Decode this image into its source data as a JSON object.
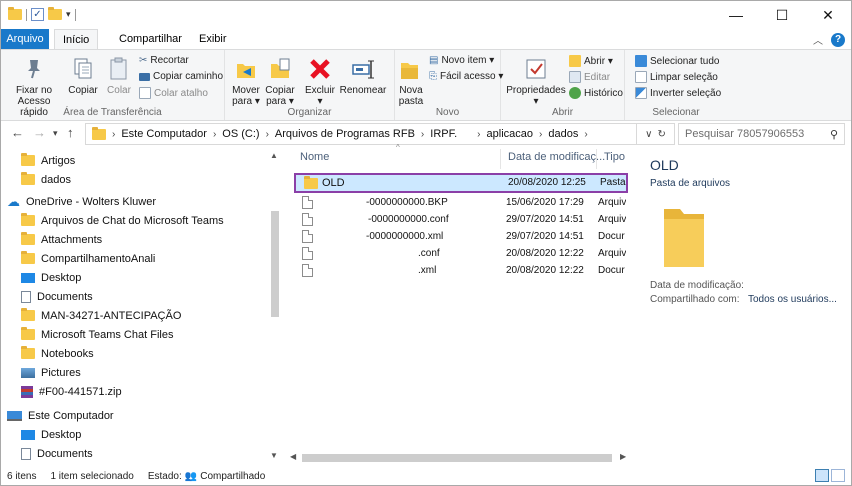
{
  "ribbon_tabs": {
    "file": "Arquivo",
    "home": "Início",
    "share": "Compartilhar",
    "view": "Exibir"
  },
  "window_controls": {
    "minimize": "—",
    "maximize": "☐",
    "close": "✕"
  },
  "clipboard": {
    "pin": "Fixar no\nAcesso rápido",
    "pin_l1": "Fixar no",
    "pin_l2": "Acesso rápido",
    "copy": "Copiar",
    "paste": "Colar",
    "cut": "Recortar",
    "copy_path": "Copiar caminho",
    "paste_shortcut": "Colar atalho",
    "group_label": "Área de Transferência"
  },
  "organize": {
    "move_l1": "Mover",
    "move_l2": "para ▾",
    "copy_l1": "Copiar",
    "copy_l2": "para ▾",
    "delete": "Excluir",
    "delete_arrow": "▾",
    "rename": "Renomear",
    "group_label": "Organizar"
  },
  "new": {
    "new_folder_l1": "Nova",
    "new_folder_l2": "pasta",
    "new_item": "Novo item ▾",
    "easy_access": "Fácil acesso ▾",
    "group_label": "Novo"
  },
  "open": {
    "properties": "Propriedades",
    "properties_arrow": "▾",
    "open": "Abrir ▾",
    "edit": "Editar",
    "history": "Histórico",
    "group_label": "Abrir"
  },
  "select": {
    "select_all": "Selecionar tudo",
    "clear": "Limpar seleção",
    "invert": "Inverter seleção",
    "group_label": "Selecionar"
  },
  "breadcrumb": [
    "Este Computador",
    "OS (C:)",
    "Arquivos de Programas RFB",
    "IRPF.",
    "aplicacao",
    "dados"
  ],
  "search": {
    "placeholder": "Pesquisar 78057906553"
  },
  "nav_items": [
    "Artigos",
    "dados",
    "OneDrive - Wolters Kluwer",
    "Arquivos de Chat do Microsoft Teams",
    "Attachments",
    "CompartilhamentoAnali",
    "Desktop",
    "Documents",
    "MAN-34271-ANTECIPAÇÃO",
    "Microsoft Teams Chat Files",
    "Notebooks",
    "Pictures",
    "#F00-441571.zip",
    "Este Computador",
    "Desktop",
    "Documents"
  ],
  "columns": {
    "name": "Nome",
    "date": "Data de modificaç...",
    "type": "Tipo"
  },
  "files": [
    {
      "name": "OLD",
      "date": "20/08/2020 12:25",
      "type": "Pasta"
    },
    {
      "name": "-0000000000.BKP",
      "date": "15/06/2020 17:29",
      "type": "Arquiv"
    },
    {
      "name": "-0000000000.conf",
      "date": "29/07/2020 14:51",
      "type": "Arquiv"
    },
    {
      "name": "-0000000000.xml",
      "date": "29/07/2020 14:51",
      "type": "Docur"
    },
    {
      "name": ".conf",
      "date": "20/08/2020 12:22",
      "type": "Arquiv"
    },
    {
      "name": ".xml",
      "date": "20/08/2020 12:22",
      "type": "Docur"
    }
  ],
  "details": {
    "title": "OLD",
    "subtitle": "Pasta de arquivos",
    "modified_label": "Data de modificação:",
    "shared_label": "Compartilhado com:",
    "shared_value": "Todos os usuários..."
  },
  "status": {
    "count": "6 itens",
    "selected": "1 item selecionado",
    "state_label": "Estado:",
    "state_value": "Compartilhado"
  },
  "colors": {
    "accent": "#1979ca",
    "selection_bg": "#cce8ff",
    "selection_border": "#8b3fa7",
    "folder": "#f7c948"
  }
}
